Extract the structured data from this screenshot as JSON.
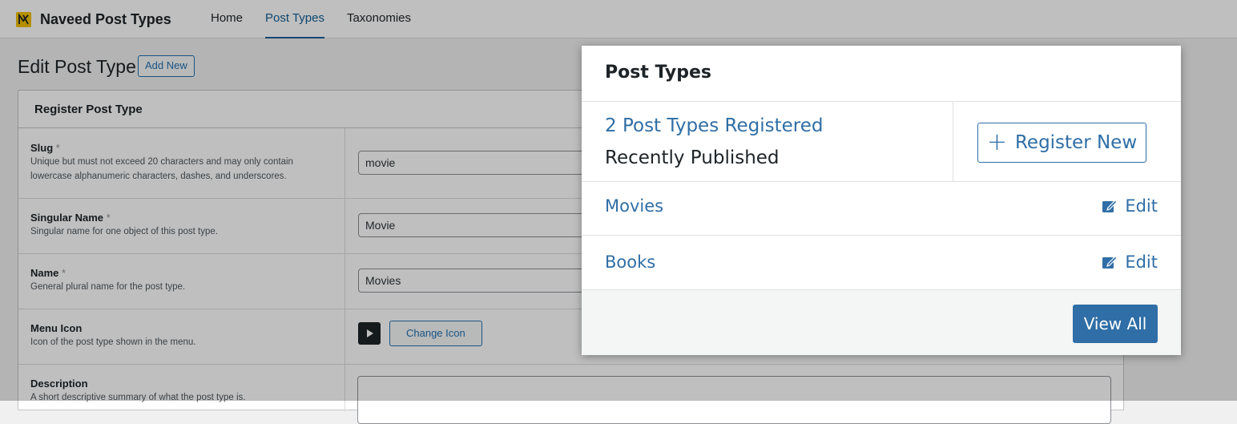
{
  "app": {
    "brand": "Naveed Post Types",
    "nav": [
      {
        "label": "Home",
        "active": false
      },
      {
        "label": "Post Types",
        "active": true
      },
      {
        "label": "Taxonomies",
        "active": false
      }
    ]
  },
  "page": {
    "title": "Edit Post Type",
    "add_new_label": "Add New"
  },
  "form": {
    "section_title": "Register Post Type",
    "required_mark": "*",
    "slug": {
      "label": "Slug",
      "description_line1": "Unique but must not exceed 20 characters and may only contain",
      "description_line2": "lowercase alphanumeric characters, dashes, and underscores.",
      "value": "movie"
    },
    "singular_name": {
      "label": "Singular Name",
      "description": "Singular name for one object of this post type.",
      "value": "Movie"
    },
    "name": {
      "label": "Name",
      "description": "General plural name for the post type.",
      "value": "Movies"
    },
    "menu_icon": {
      "label": "Menu Icon",
      "description": "Icon of the post type shown in the menu.",
      "icon": "play-icon",
      "button_label": "Change Icon"
    },
    "description": {
      "label": "Description",
      "description": "A short descriptive summary of what the post type is.",
      "value": ""
    }
  },
  "popup": {
    "title": "Post Types",
    "summary_link": "2 Post Types Registered",
    "summary_sub": "Recently Published",
    "register_label": "Register New",
    "register_icon": "plus-icon",
    "items": [
      {
        "name": "Movies",
        "edit_label": "Edit",
        "edit_icon": "edit-icon"
      },
      {
        "name": "Books",
        "edit_label": "Edit",
        "edit_icon": "edit-icon"
      }
    ],
    "view_all_label": "View All"
  },
  "colors": {
    "accent": "#2271b1",
    "popup_link": "#2f6ea6",
    "logo": "#f0c000"
  }
}
